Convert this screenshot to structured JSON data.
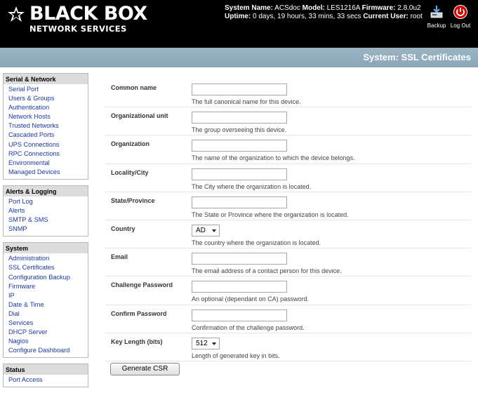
{
  "brand": {
    "name": "BLACK BOX",
    "sub": "NETWORK SERVICES"
  },
  "system": {
    "name_label": "System Name:",
    "name_value": "ACSdoc",
    "model_label": "Model:",
    "model_value": "LES1216A",
    "firmware_label": "Firmware:",
    "firmware_value": "2.8.0u2",
    "uptime_label": "Uptime:",
    "uptime_value": "0 days, 19 hours, 33 mins, 33 secs",
    "user_label": "Current User:",
    "user_value": "root"
  },
  "header_buttons": {
    "backup": "Backup",
    "logout": "Log Out"
  },
  "page_title": "System: SSL Certificates",
  "sidebar": {
    "groups": [
      {
        "title": "Serial & Network",
        "items": [
          "Serial Port",
          "Users & Groups",
          "Authentication",
          "Network Hosts",
          "Trusted Networks",
          "Cascaded Ports",
          "UPS Connections",
          "RPC Connections",
          "Environmental",
          "Managed Devices"
        ]
      },
      {
        "title": "Alerts & Logging",
        "items": [
          "Port Log",
          "Alerts",
          "SMTP & SMS",
          "SNMP"
        ]
      },
      {
        "title": "System",
        "items": [
          "Administration",
          "SSL Certificates",
          "Configuration Backup",
          "Firmware",
          "IP",
          "Date & Time",
          "Dial",
          "Services",
          "DHCP Server",
          "Nagios",
          "Configure Dashboard"
        ]
      },
      {
        "title": "Status",
        "items": [
          "Port Access"
        ]
      }
    ]
  },
  "form": {
    "common_name": {
      "label": "Common name",
      "value": "",
      "help": "The full canonical name for this device."
    },
    "org_unit": {
      "label": "Organizational unit",
      "value": "",
      "help": "The group overseeing this device."
    },
    "organization": {
      "label": "Organization",
      "value": "",
      "help": "The name of the organization to which the device belongs."
    },
    "locality": {
      "label": "Locality/City",
      "value": "",
      "help": "The City where the organization is located."
    },
    "state": {
      "label": "State/Province",
      "value": "",
      "help": "The State or Province where the organization is located."
    },
    "country": {
      "label": "Country",
      "value": "AD",
      "help": "The country where the organization is located."
    },
    "email": {
      "label": "Email",
      "value": "",
      "help": "The email address of a contact person for this device."
    },
    "challenge": {
      "label": "Challenge Password",
      "value": "",
      "help": "An optional (dependant on CA) password."
    },
    "confirm": {
      "label": "Confirm Password",
      "value": "",
      "help": "Confirmation of the challenge password."
    },
    "key_length": {
      "label": "Key Length (bits)",
      "value": "512",
      "help": "Length of generated key in bits."
    }
  },
  "generate_button": "Generate CSR",
  "colors": {
    "header_bg": "#000000",
    "titlebar": "#8fabbb",
    "link": "#1b38a8",
    "logout_red": "#cc0000"
  },
  "icons": {
    "backup": "backup-icon",
    "logout": "power-icon",
    "logo": "logo-star-icon"
  }
}
